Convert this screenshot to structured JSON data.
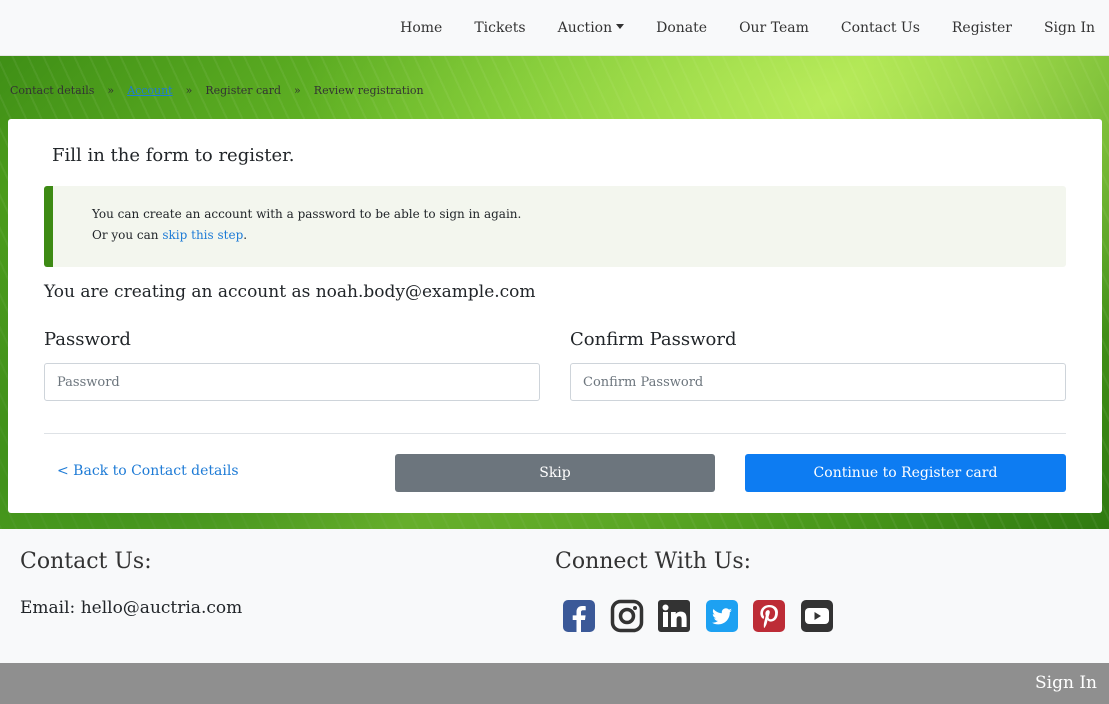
{
  "nav": {
    "items": [
      {
        "label": "Home"
      },
      {
        "label": "Tickets"
      },
      {
        "label": "Auction",
        "dropdown": true
      },
      {
        "label": "Donate"
      },
      {
        "label": "Our Team"
      },
      {
        "label": "Contact Us"
      },
      {
        "label": "Register"
      },
      {
        "label": "Sign In"
      }
    ]
  },
  "breadcrumb": {
    "separator": "»",
    "items": [
      {
        "label": "Contact details",
        "active": false
      },
      {
        "label": "Account",
        "active": true
      },
      {
        "label": "Register card",
        "active": false
      },
      {
        "label": "Review registration",
        "active": false
      }
    ]
  },
  "form": {
    "title": "Fill in the form to register.",
    "alert": {
      "line1": "You can create an account with a password to be able to sign in again.",
      "line2_prefix": "Or you can ",
      "line2_link": "skip this step",
      "line2_suffix": "."
    },
    "creating_prefix": "You are creating an account as ",
    "email": "noah.body@example.com",
    "password_label": "Password",
    "password_placeholder": "Password",
    "password_value": "",
    "confirm_label": "Confirm Password",
    "confirm_placeholder": "Confirm Password",
    "confirm_value": "",
    "back_link": "< Back to Contact details",
    "skip_button": "Skip",
    "continue_button": "Continue to Register card"
  },
  "footer": {
    "contact_heading": "Contact Us:",
    "email_label": "Email:",
    "email": "hello@auctria.com",
    "connect_heading": "Connect With Us:",
    "socials": [
      {
        "icon": "facebook-icon",
        "color": "#3b5998"
      },
      {
        "icon": "instagram-icon",
        "color": "#333333"
      },
      {
        "icon": "linkedin-icon",
        "color": "#333333"
      },
      {
        "icon": "twitter-icon",
        "color": "#1da1f2"
      },
      {
        "icon": "pinterest-icon",
        "color": "#bd2c36"
      },
      {
        "icon": "youtube-icon",
        "color": "#333333"
      }
    ]
  },
  "bottombar": {
    "sign_in": "Sign In"
  },
  "colors": {
    "primary": "#0d7cf2",
    "secondary": "#6c757d",
    "alert_accent": "#3d8a14",
    "link": "#1e7bd6"
  }
}
